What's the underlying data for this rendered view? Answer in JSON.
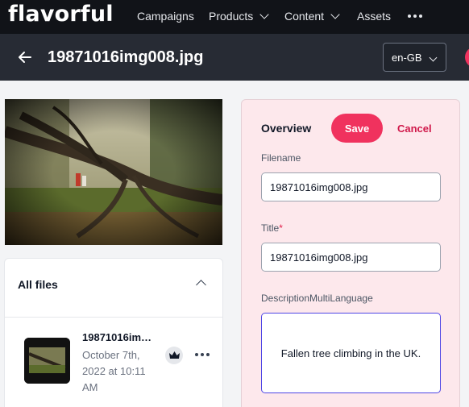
{
  "app": {
    "logo": "flavorful"
  },
  "nav": {
    "items": [
      {
        "label": "Campaigns",
        "has_dropdown": false
      },
      {
        "label": "Products",
        "has_dropdown": true
      },
      {
        "label": "Content",
        "has_dropdown": true
      },
      {
        "label": "Assets",
        "has_dropdown": false
      }
    ],
    "more_icon": "more-horizontal-icon"
  },
  "header": {
    "back_icon": "arrow-left-icon",
    "title": "19871016img008.jpg",
    "language": "en-GB"
  },
  "preview": {
    "image": "fallen-tree-photo"
  },
  "files": {
    "title": "All files",
    "items": [
      {
        "name": "19871016im…",
        "date": "October 7th, 2022 at 10:11 AM",
        "badge_icon": "crown-icon"
      }
    ]
  },
  "overview": {
    "title": "Overview",
    "save_label": "Save",
    "cancel_label": "Cancel",
    "filename_label": "Filename",
    "filename_value": "19871016img008.jpg",
    "title_label": "Title",
    "title_required_mark": "*",
    "title_value": "19871016img008.jpg",
    "description_label": "DescriptionMultiLanguage",
    "description_value": "Fallen tree climbing in the UK."
  },
  "colors": {
    "accent": "#f0325e",
    "nav_bg": "#111318",
    "header_bg": "#272b34",
    "panel_bg": "#fde8ec"
  }
}
